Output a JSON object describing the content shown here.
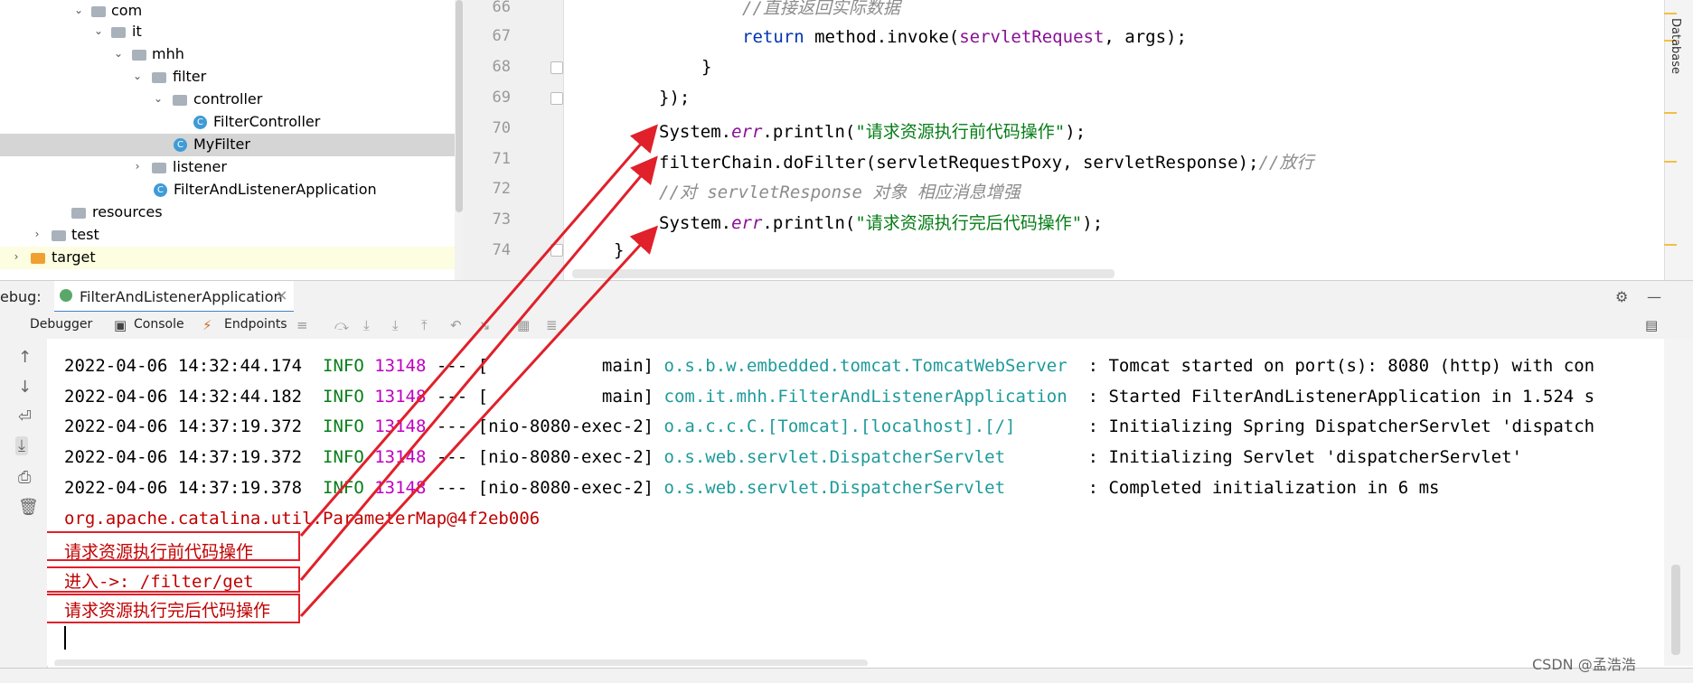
{
  "project_tree": {
    "items": [
      {
        "label": "com",
        "type": "folder",
        "expanded": true
      },
      {
        "label": "it",
        "type": "folder",
        "expanded": true
      },
      {
        "label": "mhh",
        "type": "folder",
        "expanded": true
      },
      {
        "label": "filter",
        "type": "folder",
        "expanded": true
      },
      {
        "label": "controller",
        "type": "folder",
        "expanded": true
      },
      {
        "label": "FilterController",
        "type": "class"
      },
      {
        "label": "MyFilter",
        "type": "class",
        "selected": true
      },
      {
        "label": "listener",
        "type": "folder",
        "expanded": false
      },
      {
        "label": "FilterAndListenerApplication",
        "type": "class"
      },
      {
        "label": "resources",
        "type": "folder"
      },
      {
        "label": "test",
        "type": "folder",
        "expanded": false
      },
      {
        "label": "target",
        "type": "folder-orange",
        "expanded": false
      }
    ]
  },
  "editor": {
    "line_numbers": [
      "66",
      "67",
      "68",
      "69",
      "70",
      "71",
      "72",
      "73",
      "74"
    ],
    "lines": {
      "l66": "//直接返回实际数据",
      "l67_kw": "return",
      "l67_a": " method.invoke(",
      "l67_p": "servletRequest",
      "l67_b": ", args);",
      "l68": "}",
      "l69": "});",
      "l70_a": "System.",
      "l70_err": "err",
      "l70_b": ".println(",
      "l70_str": "\"请求资源执行前代码操作\"",
      "l70_c": ");",
      "l71_a": "filterChain.doFilter(servletRequestPoxy, servletResponse);",
      "l71_cmt": "//放行",
      "l72": "//对 servletResponse 对象 相应消息增强",
      "l73_a": "System.",
      "l73_err": "err",
      "l73_b": ".println(",
      "l73_str": "\"请求资源执行完后代码操作\"",
      "l73_c": ");",
      "l74": "}"
    },
    "right_tab": "Database"
  },
  "debug": {
    "label": "ebug:",
    "tab": "FilterAndListenerApplication",
    "tabs": [
      "Debugger",
      "Console",
      "Endpoints"
    ]
  },
  "console": {
    "lines": [
      {
        "ts": "2022-04-06 14:32:44.174",
        "level": "INFO",
        "pid": "13148",
        "sep": " --- [",
        "thread": "           main]",
        "logger": "o.s.b.w.embedded.tomcat.TomcatWebServer",
        "msg": ": Tomcat started on port(s): 8080 (http) with con"
      },
      {
        "ts": "2022-04-06 14:32:44.182",
        "level": "INFO",
        "pid": "13148",
        "sep": " --- [",
        "thread": "           main]",
        "logger": "com.it.mhh.FilterAndListenerApplication",
        "msg": ": Started FilterAndListenerApplication in 1.524 s"
      },
      {
        "ts": "2022-04-06 14:37:19.372",
        "level": "INFO",
        "pid": "13148",
        "sep": " --- [",
        "thread": "nio-8080-exec-2]",
        "logger": "o.a.c.c.C.[Tomcat].[localhost].[/]",
        "msg": ": Initializing Spring DispatcherServlet 'dispatch"
      },
      {
        "ts": "2022-04-06 14:37:19.372",
        "level": "INFO",
        "pid": "13148",
        "sep": " --- [",
        "thread": "nio-8080-exec-2]",
        "logger": "o.s.web.servlet.DispatcherServlet",
        "msg": ": Initializing Servlet 'dispatcherServlet'"
      },
      {
        "ts": "2022-04-06 14:37:19.378",
        "level": "INFO",
        "pid": "13148",
        "sep": " --- [",
        "thread": "nio-8080-exec-2]",
        "logger": "o.s.web.servlet.DispatcherServlet",
        "msg": ": Completed initialization in 6 ms"
      }
    ],
    "param_map": "org.apache.catalina.util.ParameterMap@4f2eb006",
    "before": "请求资源执行前代码操作",
    "enter": "进入->: /filter/get",
    "after": "请求资源执行完后代码操作"
  },
  "watermark": "CSDN @孟浩浩",
  "colors": {
    "annotation": "#e0202a",
    "keyword": "#0033b3",
    "string": "#067d17",
    "log_info": "#067d17",
    "log_pid": "#c000c0",
    "log_logger": "#1e9a9a"
  }
}
